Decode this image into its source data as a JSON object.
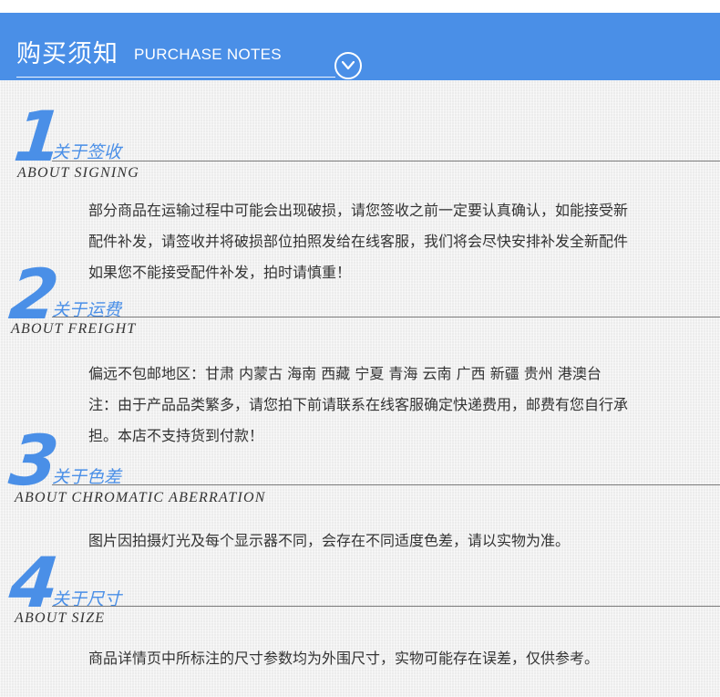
{
  "header": {
    "title": "购买须知",
    "subtitle": "PURCHASE NOTES",
    "toggle_icon": "chevron-down-icon"
  },
  "colors": {
    "accent": "#4a8fe7",
    "text": "#333333"
  },
  "sections": [
    {
      "number": "1",
      "title_cn": "关于签收",
      "title_en": "ABOUT SIGNING",
      "lines": [
        "部分商品在运输过程中可能会出现破损，请您签收之前一定要认真确认，如能接受新",
        "配件补发，请签收并将破损部位拍照发给在线客服，我们将会尽快安排补发全新配件",
        "如果您不能接受配件补发，拍时请慎重！"
      ]
    },
    {
      "number": "2",
      "title_cn": "关于运费",
      "title_en": "ABOUT FREIGHT",
      "lines": [
        "偏远不包邮地区：甘肃 内蒙古 海南 西藏 宁夏 青海 云南 广西 新疆 贵州 港澳台",
        "注：由于产品品类繁多，请您拍下前请联系在线客服确定快递费用，邮费有您自行承",
        "担。本店不支持货到付款！"
      ]
    },
    {
      "number": "3",
      "title_cn": "关于色差",
      "title_en": "ABOUT CHROMATIC ABERRATION",
      "lines": [
        "图片因拍摄灯光及每个显示器不同，会存在不同适度色差，请以实物为准。"
      ]
    },
    {
      "number": "4",
      "title_cn": "关于尺寸",
      "title_en": "ABOUT SIZE",
      "lines": [
        "商品详情页中所标注的尺寸参数均为外围尺寸，实物可能存在误差，仅供参考。"
      ]
    }
  ]
}
